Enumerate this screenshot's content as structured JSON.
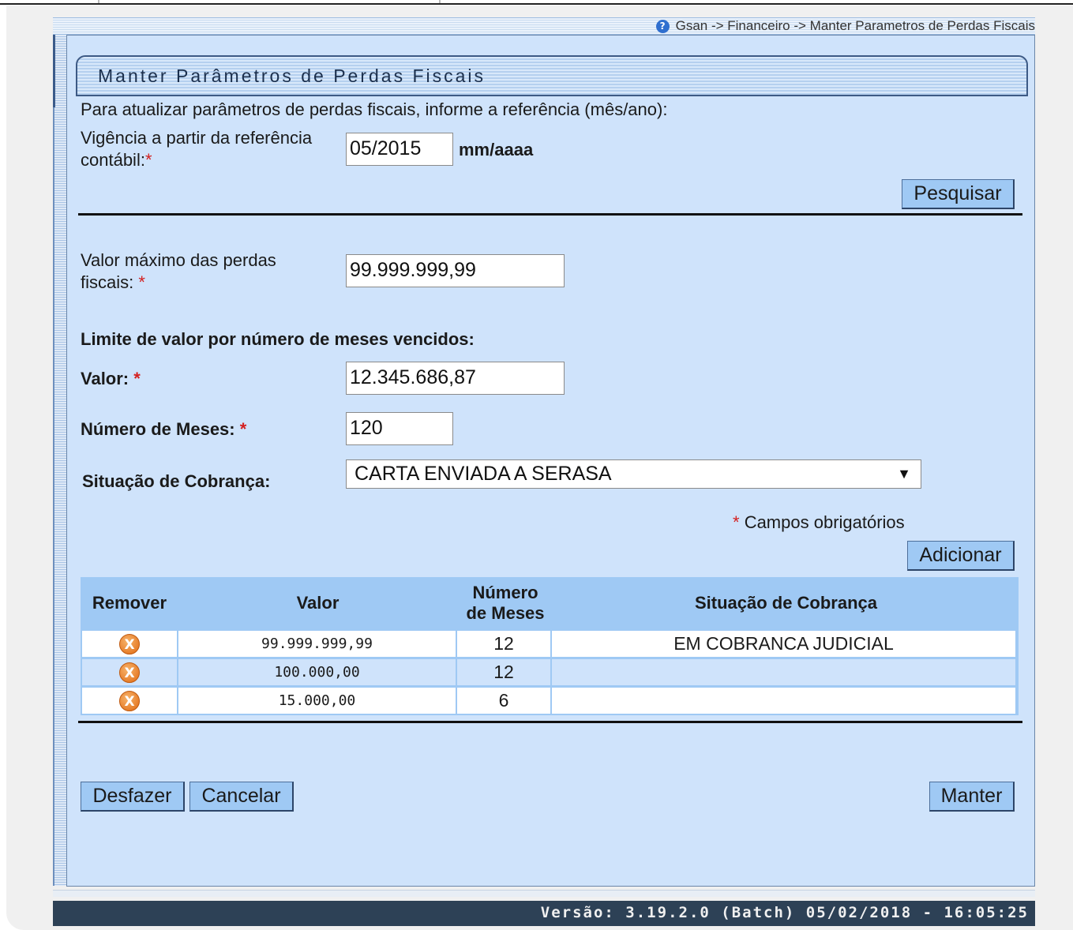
{
  "breadcrumb": "Gsan -> Financeiro -> Manter Parametros de Perdas Fiscais",
  "page_title": "Manter Parâmetros de Perdas Fiscais",
  "intro": "Para atualizar parâmetros de perdas fiscais, informe a referência (mês/ano):",
  "vigencia": {
    "label_line1": "Vigência a partir da referência",
    "label_line2": "contábil:",
    "required_mark": "*",
    "value": "05/2015",
    "format_hint": "mm/aaaa"
  },
  "search_button": "Pesquisar",
  "valor_maximo": {
    "label_line1": "Valor máximo das perdas",
    "label_line2": "fiscais:",
    "required_mark": "*",
    "value": "99.999.999,99"
  },
  "limite_section_title": "Limite de valor por número de meses vencidos:",
  "valor": {
    "label": "Valor:",
    "required_mark": "*",
    "value": "12.345.686,87"
  },
  "numero_meses": {
    "label": "Número de Meses:",
    "required_mark": "*",
    "value": "120"
  },
  "situacao": {
    "label": "Situação de Cobrança:",
    "selected": "CARTA ENVIADA A SERASA"
  },
  "required_note": {
    "mark": "*",
    "text": "Campos obrigatórios"
  },
  "add_button": "Adicionar",
  "table": {
    "headers": {
      "remover": "Remover",
      "valor": "Valor",
      "meses_line1": "Número",
      "meses_line2": "de Meses",
      "situacao": "Situação de Cobrança"
    },
    "rows": [
      {
        "valor": "99.999.999,99",
        "meses": "12",
        "situacao": "EM COBRANCA JUDICIAL"
      },
      {
        "valor": "100.000,00",
        "meses": "12",
        "situacao": ""
      },
      {
        "valor": "15.000,00",
        "meses": "6",
        "situacao": ""
      }
    ]
  },
  "buttons": {
    "undo": "Desfazer",
    "cancel": "Cancelar",
    "save": "Manter"
  },
  "footer_version": "Versão: 3.19.2.0 (Batch) 05/02/2018 - 16:05:25",
  "colors": {
    "panel": "#cfe3fb",
    "button": "#9fc9f4",
    "footer": "#2d4156",
    "required": "#d42020"
  }
}
